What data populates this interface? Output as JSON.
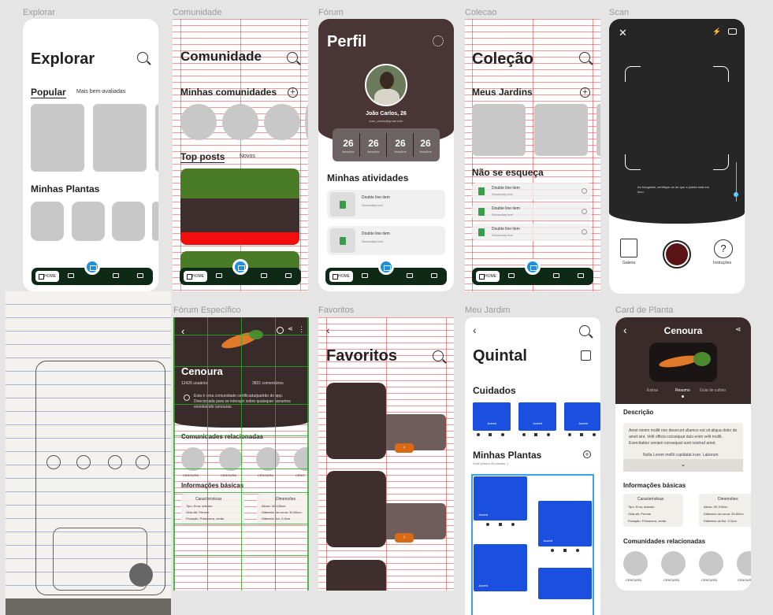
{
  "frames": {
    "explorar": {
      "label": "Explorar",
      "title": "Explorar",
      "tab_active": "Popular",
      "tab_inactive": "Mais bem-avaliadas",
      "section": "Minhas Plantas",
      "nav_home": "HOME"
    },
    "comunidade": {
      "label": "Comunidade",
      "title": "Comunidade",
      "section1": "Minhas comunidades",
      "tab_active": "Top posts",
      "tab_inactive": "Novos",
      "nav_home": "HOME"
    },
    "forum": {
      "label": "Fórum",
      "title": "Perfil",
      "name": "João Carlos, 26",
      "email": "joao_carlos@gmail.com",
      "stats": [
        {
          "value": "26",
          "label": "favoritos"
        },
        {
          "value": "26",
          "label": "favoritos"
        },
        {
          "value": "26",
          "label": "favoritos"
        },
        {
          "value": "26",
          "label": "favoritos"
        }
      ],
      "section": "Minhas atividades",
      "items": [
        {
          "title": "Double line item",
          "sub": "Secondary text"
        },
        {
          "title": "Double line item",
          "sub": "Secondary text"
        }
      ],
      "nav_home": "HOME"
    },
    "colecao": {
      "label": "Colecao",
      "title": "Coleção",
      "section1": "Meus Jardins",
      "section2": "Não se esqueça",
      "items": [
        {
          "title": "Double line item",
          "sub": "Secondary text"
        },
        {
          "title": "Double line item",
          "sub": "Secondary text"
        },
        {
          "title": "Double line item",
          "sub": "Secondary text"
        }
      ],
      "nav_home": "HOME"
    },
    "scan": {
      "label": "Scan",
      "hint": "Ao fotografar, certifique-se de que a planta está em foco.",
      "galeria": "Galeria",
      "instrucoes": "Instruções"
    },
    "forum_especifico": {
      "label": "Fórum Específico",
      "title": "Cenoura",
      "users": "12426 usuários",
      "comments": "3831 comentários",
      "desc": "Esta é uma comunidade certificada/padrão do app. Direcionada para se interagir sobre quaisquer assuntos envolvendo cenouras.",
      "section1": "Comunidades relacionadas",
      "circles": [
        "CENOURA",
        "CENOURA",
        "CENOURA",
        "CENO"
      ],
      "section2": "Informações básicas",
      "col1_title": "Características",
      "col1": [
        "Tipo: Erva, arbusto",
        "Vida útil: Perene",
        "Floração: Primavera, verão"
      ],
      "col2_title": "Dimensões",
      "col2": [
        "Altura: 30-100cm",
        "Diâmetro da coroa: 30-60cm",
        "Diâmetro flor: 2-5cm"
      ]
    },
    "favoritos": {
      "label": "Favoritos",
      "title": "Favoritos"
    },
    "meu_jardim": {
      "label": "Meu Jardim",
      "title": "Quintal",
      "section1": "Cuidados",
      "blue_label": "Juared",
      "section2": "Minhas Plantas",
      "sub2": "Você possui 05 plantas :)"
    },
    "card_planta": {
      "label": "Card de Planta",
      "title": "Cenoura",
      "tabs": [
        "Extras",
        "Resumo",
        "Guia de cultivo"
      ],
      "section1": "Descrição",
      "desc": "Amet minim mollit non deserunt ullamco est sit aliqua dolor do amet sint. Velit officia consequat duis enim velit mollit. Exercitation veniam consequat sunt nostrud amet.",
      "desc_last": "Nulla Lorem mollit cupidatat irure. Laborum",
      "section2": "Informações básicas",
      "col1_title": "Características",
      "col1": [
        "Tipo: Erva, arbusto",
        "Vida útil: Perene",
        "Floração: Primavera, verão"
      ],
      "col2_title": "Dimensões:",
      "col2": [
        "Altura: 30-100cm",
        "Diâmetro da coroa: 30-60cm",
        "Diâmetro da flor: 2-5cm"
      ],
      "section3": "Comunidades relacionadas",
      "circles": [
        "CENOURA",
        "CENOURA",
        "CENOURA",
        "CENOURA"
      ]
    }
  },
  "colors": {
    "brown": "#4a3536",
    "dark_green": "#0e2a17",
    "blue": "#1a4fe0",
    "accent_blue": "#1e8ede",
    "red": "#e63a2e",
    "green": "#3a6b23",
    "orange": "#d96a15"
  }
}
